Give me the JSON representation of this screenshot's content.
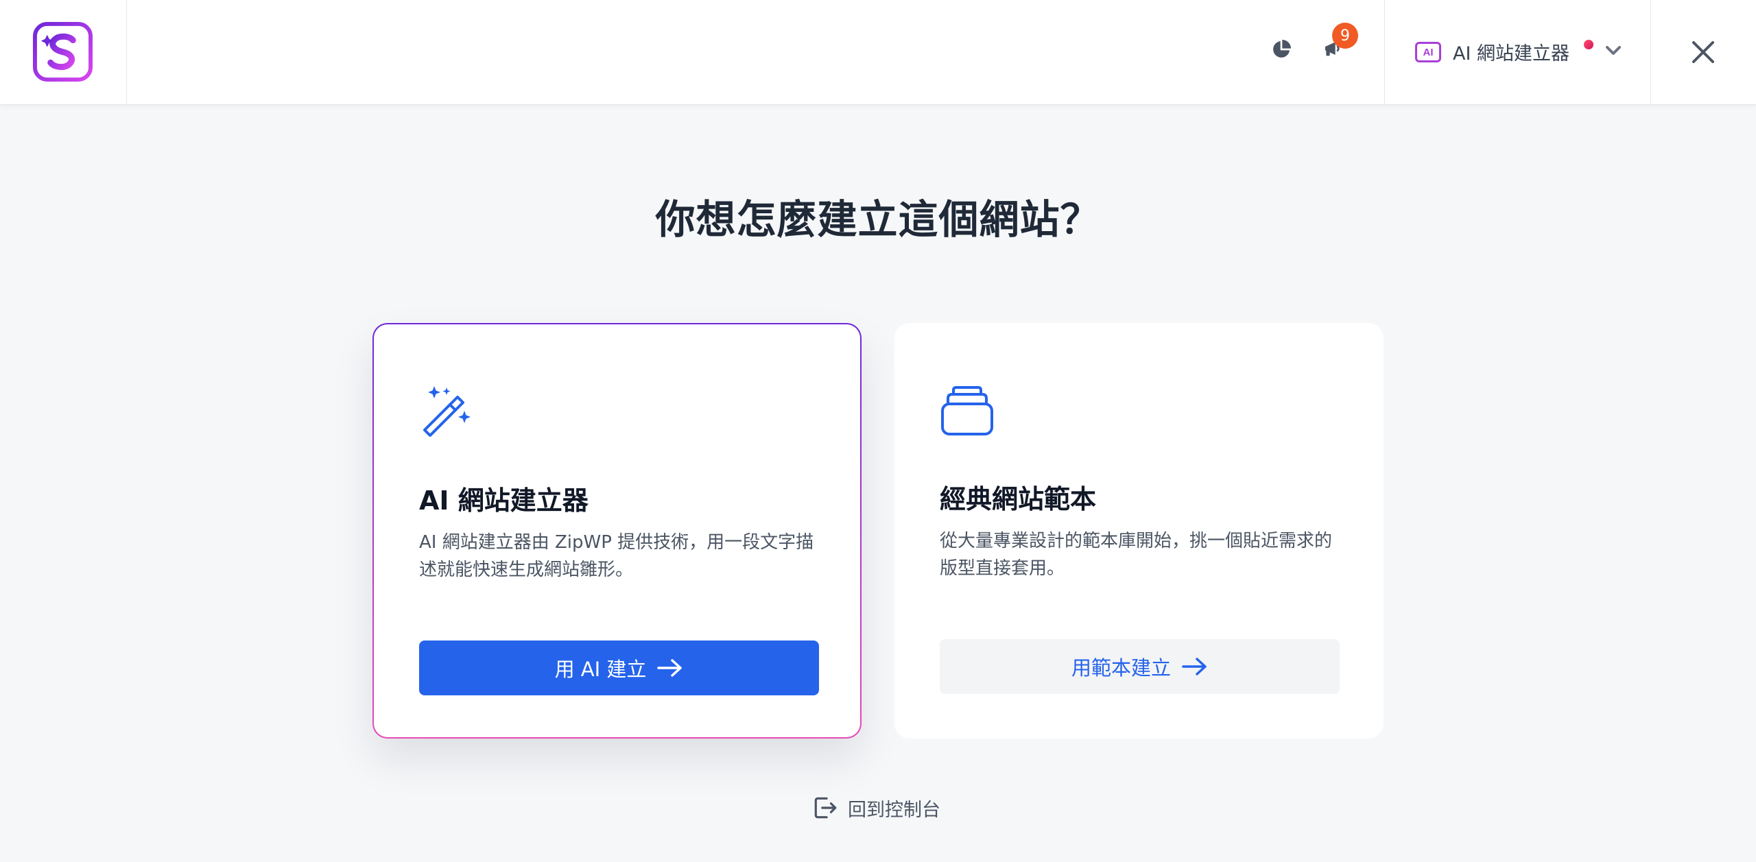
{
  "header": {
    "notification_count": "9",
    "selector": {
      "chip_text": "AI",
      "label": "AI 網站建立器"
    }
  },
  "main": {
    "title": "你想怎麼建立這個網站？",
    "cards": [
      {
        "title": "AI 網站建立器",
        "description": "AI 網站建立器由 ZipWP 提供技術，用一段文字描述就能快速生成網站雛形。",
        "button_label": "用 AI 建立",
        "icon": "magic-wand-icon",
        "selected": true
      },
      {
        "title": "經典網站範本",
        "description": "從大量專業設計的範本庫開始，挑一個貼近需求的版型直接套用。",
        "button_label": "用範本建立",
        "icon": "template-stack-icon",
        "selected": false
      }
    ],
    "back_link": "回到控制台"
  },
  "colors": {
    "primary": "#2563eb",
    "badge": "#f15a24",
    "accent_purple": "#a93fd6"
  }
}
